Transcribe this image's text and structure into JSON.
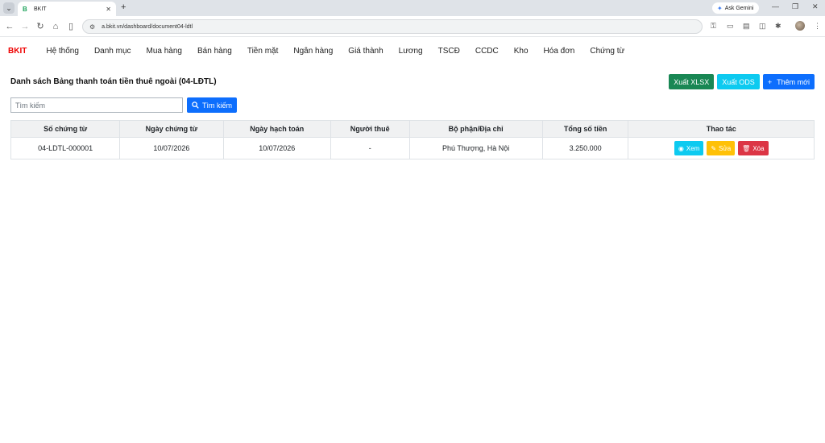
{
  "browser": {
    "tab_title": "BKIT",
    "tab_favicon": "B",
    "url": "a.bkit.vn/dashboard/document04-ldtl",
    "ask_gemini": "Ask Gemini"
  },
  "app": {
    "brand": "BKIT",
    "menu": [
      "Hệ thống",
      "Danh mục",
      "Mua hàng",
      "Bán hàng",
      "Tiền mặt",
      "Ngân hàng",
      "Giá thành",
      "Lương",
      "TSCĐ",
      "CCDC",
      "Kho",
      "Hóa đơn",
      "Chứng từ"
    ]
  },
  "page": {
    "title": "Danh sách Bảng thanh toán tiền thuê ngoài (04-LĐTL)",
    "export_xlsx": "Xuất XLSX",
    "export_ods": "Xuất ODS",
    "add_new": "Thêm mới",
    "search_placeholder": "Tìm kiếm",
    "search_button": "Tìm kiếm"
  },
  "table": {
    "headers": [
      "Số chứng từ",
      "Ngày chứng từ",
      "Ngày hạch toán",
      "Người thuê",
      "Bộ phận/Địa chỉ",
      "Tổng số tiền",
      "Thao tác"
    ],
    "rows": [
      [
        "04-LDTL-000001",
        "10/07/2026",
        "10/07/2026",
        "-",
        "Phú Thượng, Hà Nội",
        "3.250.000"
      ]
    ],
    "action_view": "Xem",
    "action_edit": "Sửa",
    "action_delete": "Xóa"
  },
  "colors": {
    "brand": "#ee0000",
    "green": "#198754",
    "cyan": "#0dcaf0",
    "blue": "#0d6efd",
    "yellow": "#ffc107",
    "red": "#dc3545"
  }
}
